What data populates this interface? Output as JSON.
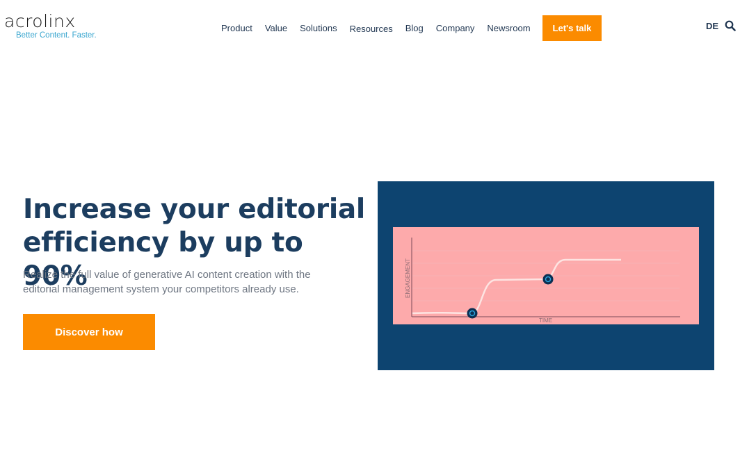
{
  "brand": {
    "name": "acrolinx",
    "tagline": "Better Content. Faster."
  },
  "nav": {
    "items": [
      "Product",
      "Value",
      "Solutions",
      "Resources",
      "Blog",
      "Company",
      "Newsroom"
    ],
    "cta": "Let's talk",
    "language": "DE",
    "search_icon": "search-icon"
  },
  "hero": {
    "title": "Increase your editorial efficiency by up to 90%",
    "subtitle": "Realize the full value of generative AI content creation with the editorial management system your competitors already use.",
    "button": "Discover how",
    "illustration": {
      "y_label": "ENGAGEMENT",
      "x_label": "TIME"
    }
  },
  "colors": {
    "accent": "#fb8b00",
    "heading": "#1c3d5f",
    "panel": "#0d4470",
    "card": "#fdaaab"
  }
}
